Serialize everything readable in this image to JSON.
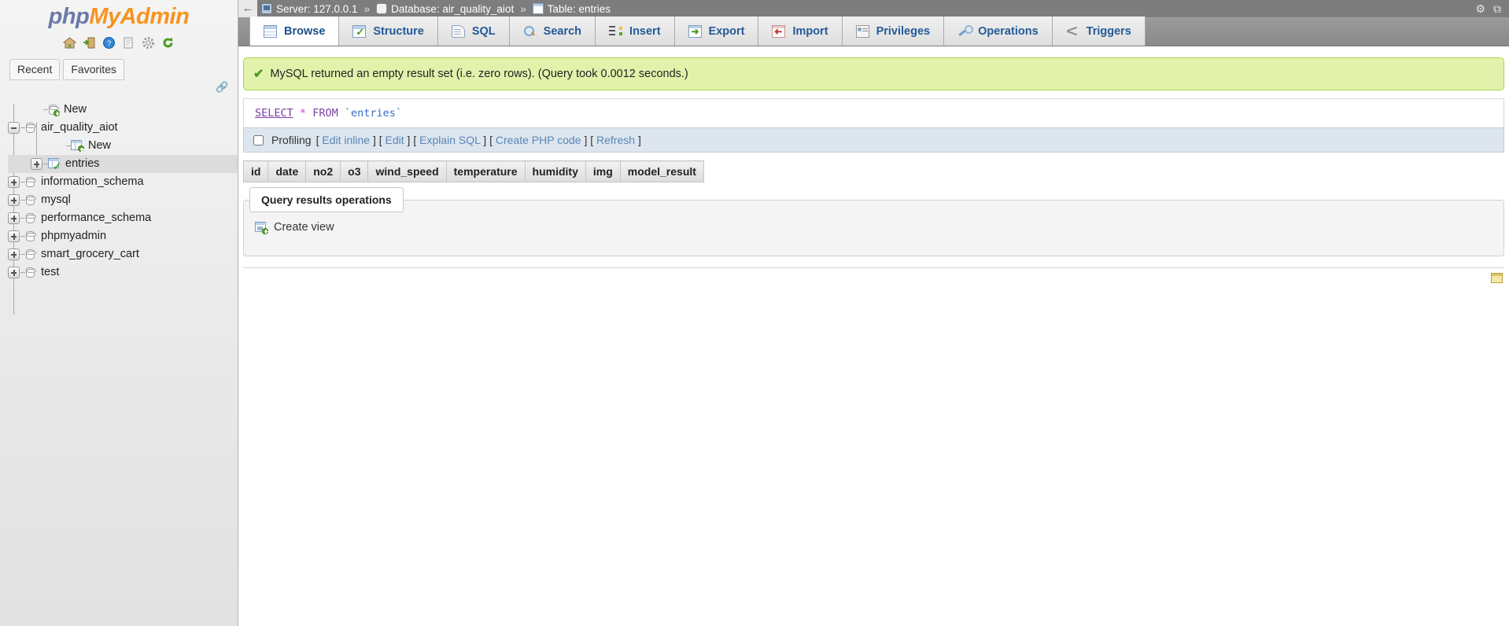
{
  "app": {
    "logo_php": "php",
    "logo_my": "MyAdmin"
  },
  "sidebar": {
    "nav_icons": [
      {
        "name": "home-icon",
        "glyph": "⌂"
      },
      {
        "name": "logout-icon",
        "glyph": "➜"
      },
      {
        "name": "help-icon",
        "glyph": "?"
      },
      {
        "name": "documentation-icon",
        "glyph": "▤"
      },
      {
        "name": "settings-icon",
        "glyph": "⚙"
      },
      {
        "name": "reload-icon",
        "glyph": "↻"
      }
    ],
    "recent_label": "Recent",
    "favorites_label": "Favorites",
    "tree": [
      {
        "label": "New",
        "type": "new-db",
        "indent": 1,
        "expander": "none"
      },
      {
        "label": "air_quality_aiot",
        "type": "db",
        "indent": 0,
        "expander": "minus"
      },
      {
        "label": "New",
        "type": "new-table",
        "indent": 2,
        "expander": "none"
      },
      {
        "label": "entries",
        "type": "table",
        "indent": 1,
        "expander": "plus",
        "selected": true
      },
      {
        "label": "information_schema",
        "type": "db",
        "indent": 0,
        "expander": "plus"
      },
      {
        "label": "mysql",
        "type": "db",
        "indent": 0,
        "expander": "plus"
      },
      {
        "label": "performance_schema",
        "type": "db",
        "indent": 0,
        "expander": "plus"
      },
      {
        "label": "phpmyadmin",
        "type": "db",
        "indent": 0,
        "expander": "plus"
      },
      {
        "label": "smart_grocery_cart",
        "type": "db",
        "indent": 0,
        "expander": "plus"
      },
      {
        "label": "test",
        "type": "db",
        "indent": 0,
        "expander": "plus"
      }
    ]
  },
  "breadcrumb": {
    "back_glyph": "←",
    "server_label": "Server: 127.0.0.1",
    "database_label": "Database: air_quality_aiot",
    "table_label": "Table: entries",
    "separator": "»",
    "settings_glyph": "⚙",
    "help_glyph": "⧉"
  },
  "tabs": [
    {
      "label": "Browse",
      "icon": "browse-icon",
      "active": true
    },
    {
      "label": "Structure",
      "icon": "structure-icon",
      "active": false
    },
    {
      "label": "SQL",
      "icon": "sql-icon",
      "active": false
    },
    {
      "label": "Search",
      "icon": "search-icon",
      "active": false
    },
    {
      "label": "Insert",
      "icon": "insert-icon",
      "active": false
    },
    {
      "label": "Export",
      "icon": "export-icon",
      "active": false
    },
    {
      "label": "Import",
      "icon": "import-icon",
      "active": false
    },
    {
      "label": "Privileges",
      "icon": "privileges-icon",
      "active": false
    },
    {
      "label": "Operations",
      "icon": "operations-icon",
      "active": false
    },
    {
      "label": "Triggers",
      "icon": "triggers-icon",
      "active": false
    }
  ],
  "result": {
    "message": "MySQL returned an empty result set (i.e. zero rows). (Query took 0.0012 seconds.)",
    "check_glyph": "✔"
  },
  "query": {
    "keyword_select": "SELECT",
    "star": "*",
    "keyword_from": "FROM",
    "identifier": "`entries`"
  },
  "profiling": {
    "label": "Profiling",
    "links": [
      {
        "label": "Edit inline"
      },
      {
        "label": "Edit"
      },
      {
        "label": "Explain SQL"
      },
      {
        "label": "Create PHP code"
      },
      {
        "label": "Refresh"
      }
    ],
    "open_bracket": "[",
    "close_bracket": "]"
  },
  "results_table": {
    "columns": [
      "id",
      "date",
      "no2",
      "o3",
      "wind_speed",
      "temperature",
      "humidity",
      "img",
      "model_result"
    ]
  },
  "query_results_operations": {
    "legend": "Query results operations",
    "create_view_label": "Create view"
  },
  "colors": {
    "success_bg": "#e3f2ab",
    "success_border": "#a5d64c",
    "link": "#5a87b8",
    "tab_text": "#235a97",
    "breadcrumb_bg": "#7d7d7d",
    "logo_orange": "#f7941e",
    "logo_blue": "#6b7aa8"
  }
}
